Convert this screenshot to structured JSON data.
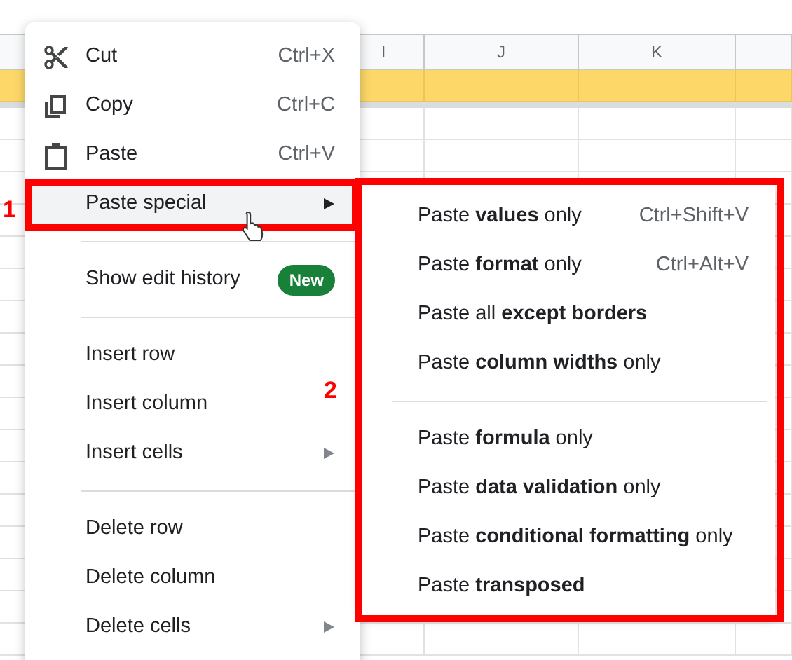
{
  "sheet": {
    "columns": [
      "I",
      "J",
      "K"
    ]
  },
  "context_menu": {
    "items": [
      {
        "kind": "item",
        "label": "Cut",
        "shortcut": "Ctrl+X",
        "highlighted": false
      },
      {
        "kind": "item",
        "label": "Copy",
        "shortcut": "Ctrl+C",
        "highlighted": false
      },
      {
        "kind": "item",
        "label": "Paste",
        "shortcut": "Ctrl+V",
        "highlighted": false
      },
      {
        "kind": "item",
        "label": "Paste special",
        "submenu": true,
        "highlighted": true
      },
      {
        "kind": "divider"
      },
      {
        "kind": "item",
        "label": "Show edit history",
        "badge": "New",
        "highlighted": false
      },
      {
        "kind": "divider"
      },
      {
        "kind": "item",
        "label": "Insert row",
        "highlighted": false
      },
      {
        "kind": "item",
        "label": "Insert column",
        "highlighted": false
      },
      {
        "kind": "item",
        "label": "Insert cells",
        "submenu": true,
        "highlighted": false
      },
      {
        "kind": "divider"
      },
      {
        "kind": "item",
        "label": "Delete row",
        "highlighted": false
      },
      {
        "kind": "item",
        "label": "Delete column",
        "highlighted": false
      },
      {
        "kind": "item",
        "label": "Delete cells",
        "submenu": true,
        "highlighted": false
      }
    ]
  },
  "submenu": {
    "items": [
      {
        "kind": "item",
        "label": "Paste **values** only",
        "shortcut": "Ctrl+Shift+V"
      },
      {
        "kind": "item",
        "label": "Paste **format** only",
        "shortcut": "Ctrl+Alt+V"
      },
      {
        "kind": "item",
        "label": "Paste all **except borders**"
      },
      {
        "kind": "item",
        "label": "Paste **column widths** only"
      },
      {
        "kind": "divider"
      },
      {
        "kind": "item",
        "label": "Paste **formula** only"
      },
      {
        "kind": "item",
        "label": "Paste **data validation** only"
      },
      {
        "kind": "item",
        "label": "Paste **conditional formatting** only"
      },
      {
        "kind": "item",
        "label": "Paste **transposed**"
      }
    ]
  },
  "annotations": [
    {
      "label": "1"
    },
    {
      "label": "2"
    }
  ]
}
